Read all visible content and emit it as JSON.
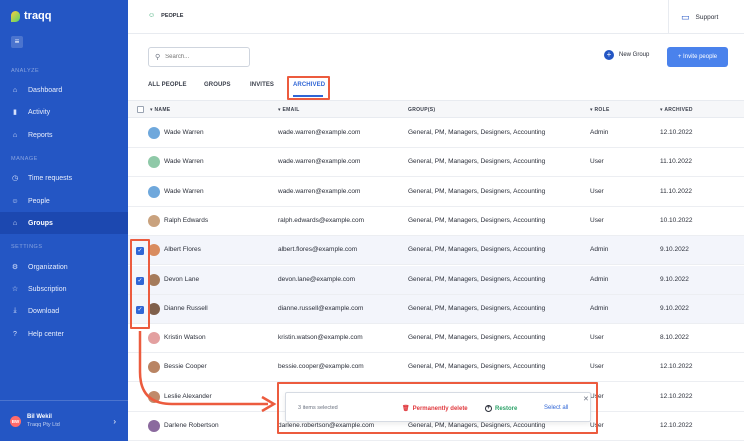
{
  "app": {
    "name": "traqq"
  },
  "sidebar": {
    "menu_icon": "hamburger-icon",
    "sections": [
      {
        "label": "ANALYZE"
      },
      {
        "label": "MANAGE"
      },
      {
        "label": "SETTINGS"
      }
    ],
    "items": [
      {
        "label": "Dashboard",
        "icon": "home-icon"
      },
      {
        "label": "Activity",
        "icon": "bar-chart-icon"
      },
      {
        "label": "Reports",
        "icon": "home-icon"
      },
      {
        "label": "Time requests",
        "icon": "clock-icon"
      },
      {
        "label": "People",
        "icon": "people-icon"
      },
      {
        "label": "Groups",
        "icon": "home-icon"
      },
      {
        "label": "Organization",
        "icon": "gear-icon"
      },
      {
        "label": "Subscription",
        "icon": "star-icon"
      },
      {
        "label": "Download",
        "icon": "download-icon"
      },
      {
        "label": "Help center",
        "icon": "help-icon"
      }
    ],
    "user": {
      "initials": "BW",
      "name": "Bil Wekil",
      "org": "Traqq Pty Ltd"
    }
  },
  "header": {
    "breadcrumb": "PEOPLE",
    "support": "Support"
  },
  "toolbar": {
    "search_placeholder": "Search...",
    "new_group": "New Group",
    "invite": "+ Invite people"
  },
  "tabs": [
    "ALL PEOPLE",
    "GROUPS",
    "INVITES",
    "ARCHIVED"
  ],
  "table": {
    "headers": [
      "NAME",
      "EMAIL",
      "GROUP(S)",
      "ROLE",
      "ARCHIVED"
    ],
    "rows": [
      {
        "name": "Wade Warren",
        "email": "wade.warren@example.com",
        "groups": "General, PM, Managers, Designers, Accounting",
        "role": "Admin",
        "archived": "12.10.2022",
        "selected": false
      },
      {
        "name": "Wade Warren",
        "email": "wade.warren@example.com",
        "groups": "General, PM, Managers, Designers, Accounting",
        "role": "User",
        "archived": "11.10.2022",
        "selected": false
      },
      {
        "name": "Wade Warren",
        "email": "wade.warren@example.com",
        "groups": "General, PM, Managers, Designers, Accounting",
        "role": "User",
        "archived": "11.10.2022",
        "selected": false
      },
      {
        "name": "Ralph Edwards",
        "email": "ralph.edwards@example.com",
        "groups": "General, PM, Managers, Designers, Accounting",
        "role": "User",
        "archived": "10.10.2022",
        "selected": false
      },
      {
        "name": "Albert Flores",
        "email": "albert.flores@example.com",
        "groups": "General, PM, Managers, Designers, Accounting",
        "role": "Admin",
        "archived": "9.10.2022",
        "selected": true
      },
      {
        "name": "Devon Lane",
        "email": "devon.lane@example.com",
        "groups": "General, PM, Managers, Designers, Accounting",
        "role": "Admin",
        "archived": "9.10.2022",
        "selected": true
      },
      {
        "name": "Dianne Russell",
        "email": "dianne.russell@example.com",
        "groups": "General, PM, Managers, Designers, Accounting",
        "role": "Admin",
        "archived": "9.10.2022",
        "selected": true
      },
      {
        "name": "Kristin Watson",
        "email": "kristin.watson@example.com",
        "groups": "General, PM, Managers, Designers, Accounting",
        "role": "User",
        "archived": "8.10.2022",
        "selected": false
      },
      {
        "name": "Bessie Cooper",
        "email": "bessie.cooper@example.com",
        "groups": "General, PM, Managers, Designers, Accounting",
        "role": "User",
        "archived": "12.10.2022",
        "selected": false
      },
      {
        "name": "Leslie Alexander",
        "email": "",
        "groups": "",
        "role": "User",
        "archived": "12.10.2022",
        "selected": false
      },
      {
        "name": "Darlene Robertson",
        "email": "darlene.robertson@example.com",
        "groups": "General, PM, Managers, Designers, Accounting",
        "role": "User",
        "archived": "12.10.2022",
        "selected": false
      }
    ]
  },
  "action_bar": {
    "count": "3 items selected",
    "delete": "Permanently delete",
    "restore": "Restore",
    "select_all": "Select all"
  },
  "colors": {
    "sidebar": "#2456c4",
    "accent": "#3066d6",
    "highlight": "#ec5b3e",
    "danger": "#e0393e",
    "success": "#2ea36a"
  }
}
